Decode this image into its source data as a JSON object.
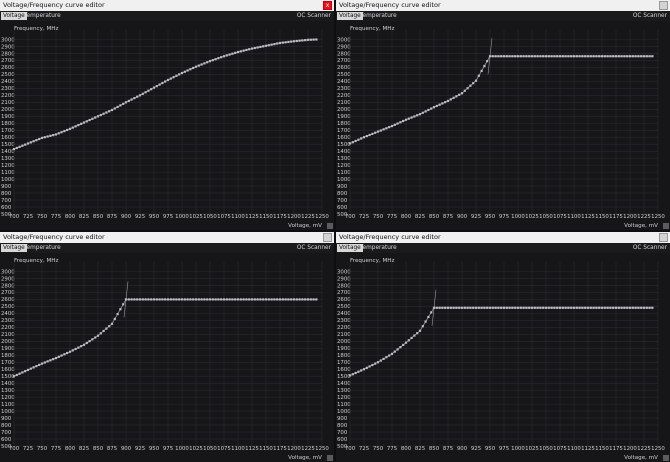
{
  "windows": [
    {
      "title": "Voltage/Frequency curve editor",
      "close_label": "x",
      "close_active": true,
      "tabs": [
        "Voltage",
        "Temperature"
      ],
      "right_tab": "OC Scanner",
      "y_axis_label": "Frequency, MHz",
      "x_axis_label": "Voltage, mV",
      "y_ticks": [
        3000,
        2900,
        2800,
        2700,
        2600,
        2500,
        2400,
        2300,
        2200,
        2100,
        2000,
        1900,
        1800,
        1700,
        1600,
        1500,
        1400,
        1300,
        1200,
        1100,
        1000,
        900,
        800,
        700,
        600,
        500
      ],
      "x_ticks": [
        700,
        725,
        750,
        775,
        800,
        825,
        850,
        875,
        900,
        925,
        950,
        975,
        1000,
        1025,
        1050,
        1075,
        1100,
        1125,
        1150,
        1175,
        1200,
        1225,
        1250
      ]
    },
    {
      "title": "Voltage/Frequency curve editor",
      "close_label": "",
      "close_active": false,
      "tabs": [
        "Voltage",
        "Temperature"
      ],
      "right_tab": "OC Scanner",
      "y_axis_label": "Frequency, MHz",
      "x_axis_label": "Voltage, mV",
      "y_ticks": [
        3000,
        2900,
        2800,
        2700,
        2600,
        2500,
        2400,
        2300,
        2200,
        2100,
        2000,
        1900,
        1800,
        1700,
        1600,
        1500,
        1400,
        1300,
        1200,
        1100,
        1000,
        900,
        800,
        700,
        600,
        500
      ],
      "x_ticks": [
        700,
        725,
        750,
        775,
        800,
        825,
        850,
        875,
        900,
        925,
        950,
        975,
        1000,
        1025,
        1050,
        1075,
        1100,
        1125,
        1150,
        1175,
        1200,
        1225,
        1250
      ]
    },
    {
      "title": "Voltage/Frequency curve editor",
      "close_label": "",
      "close_active": false,
      "tabs": [
        "Voltage",
        "Temperature"
      ],
      "right_tab": "OC Scanner",
      "y_axis_label": "Frequency, MHz",
      "x_axis_label": "Voltage, mV",
      "y_ticks": [
        3000,
        2900,
        2800,
        2700,
        2600,
        2500,
        2400,
        2300,
        2200,
        2100,
        2000,
        1900,
        1800,
        1700,
        1600,
        1500,
        1400,
        1300,
        1200,
        1100,
        1000,
        900,
        800,
        700,
        600,
        500
      ],
      "x_ticks": [
        700,
        725,
        750,
        775,
        800,
        825,
        850,
        875,
        900,
        925,
        950,
        975,
        1000,
        1025,
        1050,
        1075,
        1100,
        1125,
        1150,
        1175,
        1200,
        1225,
        1250
      ]
    },
    {
      "title": "Voltage/Frequency curve editor",
      "close_label": "",
      "close_active": false,
      "tabs": [
        "Voltage",
        "Temperature"
      ],
      "right_tab": "OC Scanner",
      "y_axis_label": "Frequency, MHz",
      "x_axis_label": "Voltage, mV",
      "y_ticks": [
        3000,
        2900,
        2800,
        2700,
        2600,
        2500,
        2400,
        2300,
        2200,
        2100,
        2000,
        1900,
        1800,
        1700,
        1600,
        1500,
        1400,
        1300,
        1200,
        1100,
        1000,
        900,
        800,
        700,
        600,
        500
      ],
      "x_ticks": [
        700,
        725,
        750,
        775,
        800,
        825,
        850,
        875,
        900,
        925,
        950,
        975,
        1000,
        1025,
        1050,
        1075,
        1100,
        1125,
        1150,
        1175,
        1200,
        1225,
        1250
      ]
    }
  ],
  "chart_data": [
    {
      "type": "scatter",
      "xlabel": "Voltage, mV",
      "ylabel": "Frequency, MHz",
      "xlim": [
        700,
        1250
      ],
      "ylim": [
        500,
        3050
      ],
      "curve": [
        [
          700,
          1430
        ],
        [
          725,
          1510
        ],
        [
          750,
          1590
        ],
        [
          775,
          1640
        ],
        [
          800,
          1720
        ],
        [
          825,
          1810
        ],
        [
          850,
          1900
        ],
        [
          875,
          1990
        ],
        [
          900,
          2100
        ],
        [
          925,
          2200
        ],
        [
          950,
          2310
        ],
        [
          975,
          2420
        ],
        [
          1000,
          2520
        ],
        [
          1025,
          2610
        ],
        [
          1050,
          2690
        ],
        [
          1075,
          2760
        ],
        [
          1100,
          2820
        ],
        [
          1125,
          2870
        ],
        [
          1150,
          2910
        ],
        [
          1175,
          2950
        ],
        [
          1200,
          2975
        ],
        [
          1225,
          2995
        ],
        [
          1240,
          3000
        ]
      ],
      "flat_from": null,
      "flat_level": null
    },
    {
      "type": "scatter",
      "xlabel": "Voltage, mV",
      "ylabel": "Frequency, MHz",
      "xlim": [
        700,
        1250
      ],
      "ylim": [
        500,
        3050
      ],
      "curve": [
        [
          700,
          1510
        ],
        [
          725,
          1600
        ],
        [
          750,
          1680
        ],
        [
          775,
          1760
        ],
        [
          800,
          1850
        ],
        [
          825,
          1930
        ],
        [
          850,
          2030
        ],
        [
          875,
          2120
        ],
        [
          900,
          2230
        ],
        [
          925,
          2410
        ],
        [
          950,
          2760
        ]
      ],
      "flat_from": 950,
      "flat_level": 2760
    },
    {
      "type": "scatter",
      "xlabel": "Voltage, mV",
      "ylabel": "Frequency, MHz",
      "xlim": [
        700,
        1250
      ],
      "ylim": [
        500,
        3050
      ],
      "curve": [
        [
          700,
          1500
        ],
        [
          725,
          1590
        ],
        [
          750,
          1680
        ],
        [
          775,
          1760
        ],
        [
          800,
          1850
        ],
        [
          825,
          1950
        ],
        [
          850,
          2080
        ],
        [
          875,
          2250
        ],
        [
          900,
          2600
        ]
      ],
      "flat_from": 900,
      "flat_level": 2600
    },
    {
      "type": "scatter",
      "xlabel": "Voltage, mV",
      "ylabel": "Frequency, MHz",
      "xlim": [
        700,
        1250
      ],
      "ylim": [
        500,
        3050
      ],
      "curve": [
        [
          700,
          1510
        ],
        [
          725,
          1600
        ],
        [
          750,
          1700
        ],
        [
          775,
          1820
        ],
        [
          800,
          1980
        ],
        [
          825,
          2150
        ],
        [
          850,
          2480
        ]
      ],
      "flat_from": 850,
      "flat_level": 2480
    }
  ]
}
